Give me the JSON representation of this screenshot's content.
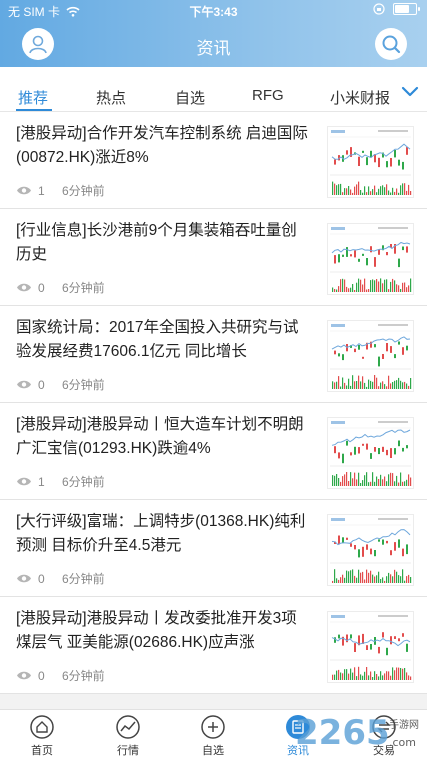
{
  "status": {
    "carrier": "无 SIM 卡",
    "time": "下午3:43",
    "battery_level": 0.7
  },
  "header": {
    "title": "资讯",
    "avatar_icon": "user-icon",
    "search_icon": "search-icon"
  },
  "tabs": [
    {
      "label": "推荐",
      "active": true
    },
    {
      "label": "热点",
      "active": false
    },
    {
      "label": "自选",
      "active": false
    },
    {
      "label": "RFG",
      "active": false
    },
    {
      "label": "小米财报",
      "active": false
    }
  ],
  "news": [
    {
      "title": "[港股异动]合作开发汽车控制系统 启迪国际(00872.HK)涨近8%",
      "views": "1",
      "time": "6分钟前"
    },
    {
      "title": "[行业信息]长沙港前9个月集装箱吞吐量创历史",
      "views": "0",
      "time": "6分钟前"
    },
    {
      "title": "国家统计局：2017年全国投入共研究与试验发展经费17606.1亿元 同比增长",
      "views": "0",
      "time": "6分钟前"
    },
    {
      "title": "[港股异动]港股异动丨恒大造车计划不明朗 广汇宝信(01293.HK)跌逾4%",
      "views": "1",
      "time": "6分钟前"
    },
    {
      "title": "[大行评级]富瑞：上调特步(01368.HK)纯利预测 目标价升至4.5港元",
      "views": "0",
      "time": "6分钟前"
    },
    {
      "title": "[港股异动]港股异动丨发改委批准开发3项煤层气 亚美能源(02686.HK)应声涨",
      "views": "0",
      "time": "6分钟前"
    }
  ],
  "nav": [
    {
      "label": "首页",
      "icon": "home-icon",
      "active": false
    },
    {
      "label": "行情",
      "icon": "market-chart-icon",
      "active": false
    },
    {
      "label": "自选",
      "icon": "add-circle-icon",
      "active": false
    },
    {
      "label": "资讯",
      "icon": "news-icon",
      "active": true
    },
    {
      "label": "交易",
      "icon": "trade-icon",
      "active": false
    }
  ],
  "watermark": {
    "text_main": "2265",
    "text_domain": ".com",
    "text_side": "手游网"
  },
  "colors": {
    "accent": "#2e8ad8",
    "header_start": "#62a9e2",
    "header_end": "#a8d0ef"
  }
}
